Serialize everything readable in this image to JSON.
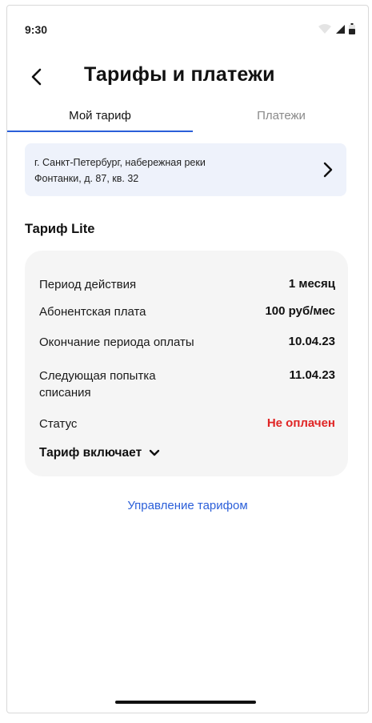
{
  "status_bar": {
    "time": "9:30",
    "icons": [
      "wifi-icon",
      "signal-icon",
      "battery-icon"
    ]
  },
  "header": {
    "title": "Тарифы и платежи",
    "back_icon": "chevron-left-icon"
  },
  "tabs": [
    {
      "label": "Мой тариф",
      "active": true
    },
    {
      "label": "Платежи",
      "active": false
    }
  ],
  "address": {
    "line1": "г. Санкт-Петербург, набережная реки",
    "line2": "Фонтанки, д. 87, кв. 32",
    "icon": "chevron-right-icon"
  },
  "tariff": {
    "title": "Тариф Lite",
    "rows": [
      {
        "label": "Период действия",
        "value": "1 месяц"
      },
      {
        "label": "Абонентская плата",
        "value": "100 руб/мес"
      },
      {
        "label": "Окончание периода оплаты",
        "value": "10.04.23"
      },
      {
        "label": "Следующая попытка списания",
        "value": "11.04.23"
      },
      {
        "label": "Статус",
        "value": "Не оплачен"
      }
    ],
    "includes_label": "Тариф включает",
    "includes_icon": "chevron-down-icon"
  },
  "manage_link": "Управление тарифом",
  "colors": {
    "accent": "#2b5fd9",
    "status_unpaid": "#e02424",
    "card_bg": "#f5f5f5",
    "address_bg": "#eef2fb"
  }
}
